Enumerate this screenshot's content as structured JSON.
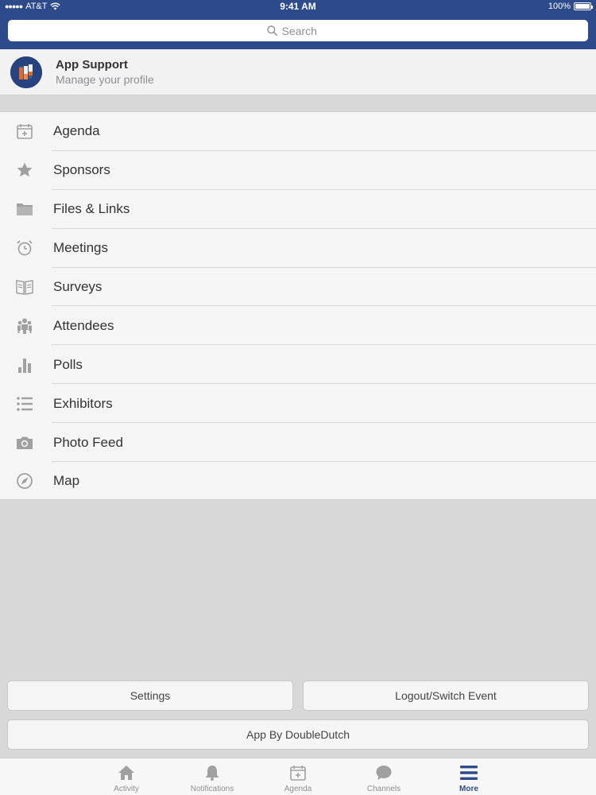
{
  "status_bar": {
    "signal": "●●●●●",
    "carrier": "AT&T",
    "time": "9:41 AM",
    "battery": "100%"
  },
  "search": {
    "placeholder": "Search"
  },
  "profile": {
    "name": "App Support",
    "subtitle": "Manage your profile"
  },
  "menu": {
    "items": [
      {
        "label": "Agenda",
        "icon": "calendar-icon"
      },
      {
        "label": "Sponsors",
        "icon": "star-icon"
      },
      {
        "label": "Files & Links",
        "icon": "folder-icon"
      },
      {
        "label": "Meetings",
        "icon": "alarm-clock-icon"
      },
      {
        "label": "Surveys",
        "icon": "book-icon"
      },
      {
        "label": "Attendees",
        "icon": "people-icon"
      },
      {
        "label": "Polls",
        "icon": "bar-chart-icon"
      },
      {
        "label": "Exhibitors",
        "icon": "list-icon"
      },
      {
        "label": "Photo Feed",
        "icon": "camera-icon"
      },
      {
        "label": "Map",
        "icon": "compass-icon"
      }
    ]
  },
  "buttons": {
    "settings": "Settings",
    "logout": "Logout/Switch Event",
    "app_by": "App By DoubleDutch"
  },
  "tabbar": {
    "tabs": [
      {
        "label": "Activity",
        "icon": "home-icon"
      },
      {
        "label": "Notifications",
        "icon": "bell-icon"
      },
      {
        "label": "Agenda",
        "icon": "calendar-icon"
      },
      {
        "label": "Channels",
        "icon": "chat-bubble-icon"
      },
      {
        "label": "More",
        "icon": "menu-icon",
        "active": true
      }
    ]
  },
  "colors": {
    "header": "#2d4a8a",
    "icon_gray": "#a0a0a0",
    "active_tab": "#2d4a8a"
  }
}
